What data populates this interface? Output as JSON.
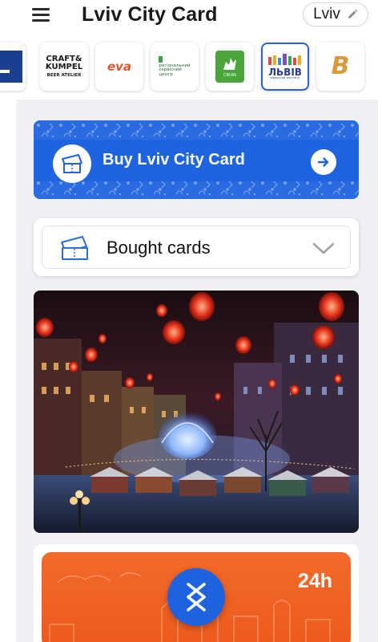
{
  "header": {
    "title": "Lviv City Card",
    "city": "Lviv"
  },
  "partners": [
    {
      "name": "partner-unknown-blue",
      "selected": false
    },
    {
      "name": "Craft & Kumpel Beer Atelier",
      "line1": "CRAFT&",
      "line2": "KUMPEL",
      "line3": "BEER ATELIER",
      "selected": false
    },
    {
      "name": "Eva",
      "text": "eva",
      "selected": false
    },
    {
      "name": "Regional service center",
      "line1": "регіональний",
      "line2": "сервісний",
      "line3": "центр",
      "selected": false
    },
    {
      "name": "Green partner",
      "text": "CRUIN",
      "selected": false
    },
    {
      "name": "Lviv",
      "text": "ЛЬВІВ",
      "sub": "відкритий для світу",
      "selected": true
    },
    {
      "name": "partner-letter-b",
      "text": "B",
      "selected": false
    }
  ],
  "buy": {
    "label": "Buy Lviv City Card"
  },
  "bought": {
    "label": "Bought cards"
  },
  "promo_card": {
    "duration": "24h"
  },
  "colors": {
    "accent": "#1e63e0",
    "card_orange": "#ef6225",
    "background": "#eef0f4"
  }
}
